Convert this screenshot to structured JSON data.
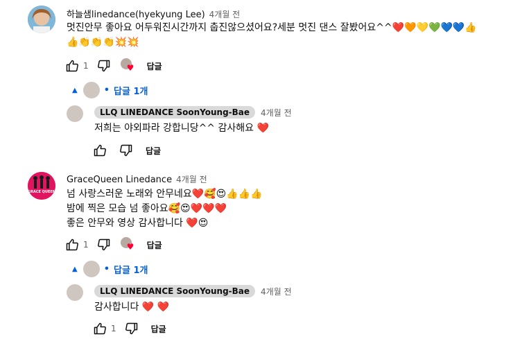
{
  "comments": [
    {
      "author": "하늘샘linedance(hyekyung Lee)",
      "time": "4개월 전",
      "lines": [
        "멋진안무 좋아요 어두워진시간까지 춥진않으셨어요?세분 멋진 댄스 잘봤어요^^❤️🧡💛💚💙💙👍",
        "👍👏👏👏💥💥"
      ],
      "likes": "1",
      "reply_label": "답글",
      "replies_toggle": "답글 1개",
      "reply": {
        "author": "LLQ LINEDANCE SoonYoung-Bae",
        "time": "4개월 전",
        "text": "저희는 야외파라 강합니당^^  감사해요 ❤️",
        "likes": "",
        "reply_label": "답글"
      }
    },
    {
      "author": "GraceQueen Linedance",
      "time": "4개월 전",
      "avatar_text": "GRACE QUEEN",
      "lines": [
        "넘 사랑스러운 노래와 안무네요❤️🥰😍👍👍👍",
        "밤에 찍은 모습 넘 좋아요🥰😍❤️❤️❤️",
        "좋은 안무와 영상 감사합니다 ❤️😍"
      ],
      "likes": "1",
      "reply_label": "답글",
      "replies_toggle": "답글 1개",
      "reply": {
        "author": "LLQ LINEDANCE SoonYoung-Bae",
        "time": "4개월 전",
        "text": "감사합니다 ❤️ ❤️",
        "likes": "1",
        "reply_label": "답글"
      }
    }
  ],
  "colors": {
    "link": "#065fd4",
    "heart": "#ff0033",
    "muted": "#606060"
  }
}
